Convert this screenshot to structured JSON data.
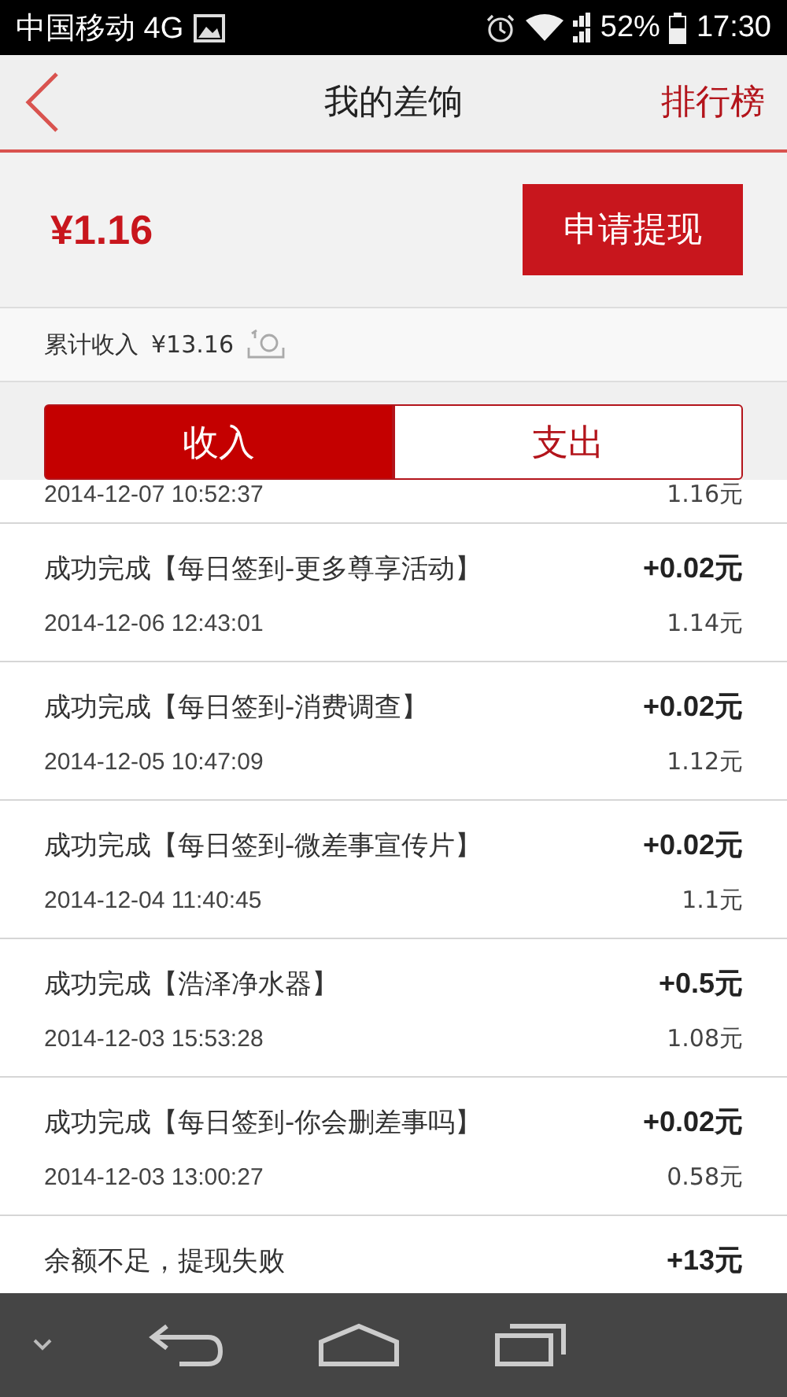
{
  "status_bar": {
    "carrier": "中国移动 4G",
    "battery": "52%",
    "time": "17:30"
  },
  "header": {
    "title": "我的差饷",
    "action": "排行榜"
  },
  "balance": {
    "amount": "¥1.16",
    "button": "申请提现"
  },
  "total": {
    "label": "累计收入",
    "amount": "¥13.16"
  },
  "tabs": [
    {
      "label": "收入",
      "selected": true
    },
    {
      "label": "支出",
      "selected": false
    }
  ],
  "records": [
    {
      "date": "2014-12-07 10:52:37",
      "balance": "1.16元"
    },
    {
      "title": "成功完成【每日签到-更多尊享活动】",
      "amount": "+0.02元",
      "date": "2014-12-06 12:43:01",
      "balance": "1.14元"
    },
    {
      "title": "成功完成【每日签到-消费调查】",
      "amount": "+0.02元",
      "date": "2014-12-05 10:47:09",
      "balance": "1.12元"
    },
    {
      "title": "成功完成【每日签到-微差事宣传片】",
      "amount": "+0.02元",
      "date": "2014-12-04 11:40:45",
      "balance": "1.1元"
    },
    {
      "title": "成功完成【浩泽净水器】",
      "amount": "+0.5元",
      "date": "2014-12-03 15:53:28",
      "balance": "1.08元"
    },
    {
      "title": "成功完成【每日签到-你会删差事吗】",
      "amount": "+0.02元",
      "date": "2014-12-03 13:00:27",
      "balance": "0.58元"
    },
    {
      "title": "余额不足，提现失败",
      "amount": "+13元"
    }
  ]
}
